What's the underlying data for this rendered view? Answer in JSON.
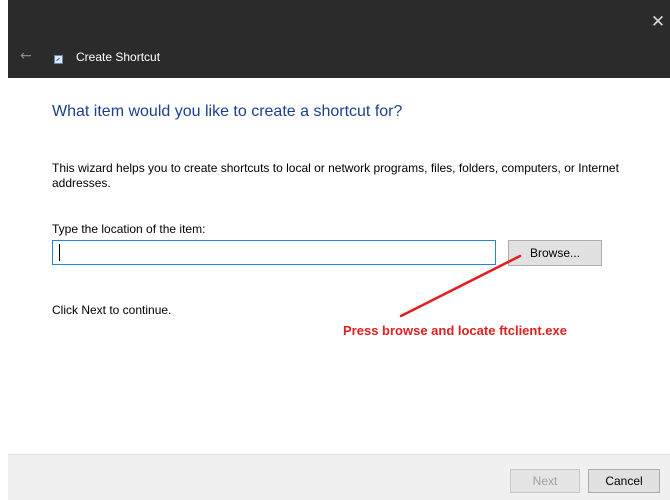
{
  "window": {
    "title": "Create Shortcut",
    "close_glyph": "✕",
    "back_glyph": "←",
    "titlebar_color": "#2b2b2b"
  },
  "wizard": {
    "heading": "What item would you like to create a shortcut for?",
    "description": "This wizard helps you to create shortcuts to local or network programs, files, folders, computers, or Internet addresses.",
    "location_label": "Type the location of the item:",
    "location_value": "",
    "location_placeholder": "",
    "browse_label": "Browse...",
    "continue_hint": "Click Next to continue."
  },
  "annotation": {
    "text": "Press browse and locate ftclient.exe",
    "color": "#e02020"
  },
  "footer": {
    "next_label": "Next",
    "next_enabled": false,
    "cancel_label": "Cancel"
  },
  "colors": {
    "heading_blue": "#1e3f8f",
    "focus_border": "#1f86d8"
  }
}
